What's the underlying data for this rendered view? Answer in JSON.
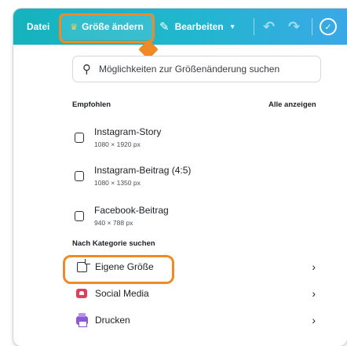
{
  "toolbar": {
    "file_label": "Datei",
    "resize_label": "Größe ändern",
    "edit_label": "Bearbeiten",
    "accent_color": "#f08a24"
  },
  "search": {
    "placeholder": "Möglichkeiten zur Größenänderung suchen"
  },
  "recommended": {
    "heading": "Empfohlen",
    "see_all": "Alle anzeigen",
    "items": [
      {
        "title": "Instagram-Story",
        "size": "1080 × 1920 px"
      },
      {
        "title": "Instagram-Beitrag (4:5)",
        "size": "1080 × 1350 px"
      },
      {
        "title": "Facebook-Beitrag",
        "size": "940 × 788 px"
      }
    ]
  },
  "categories": {
    "heading": "Nach Kategorie suchen",
    "items": [
      {
        "label": "Eigene Größe",
        "icon": "custom-size-icon"
      },
      {
        "label": "Social Media",
        "icon": "social-media-icon",
        "color": "#e33f5a"
      },
      {
        "label": "Drucken",
        "icon": "print-icon",
        "color": "#8c58d6"
      }
    ]
  }
}
